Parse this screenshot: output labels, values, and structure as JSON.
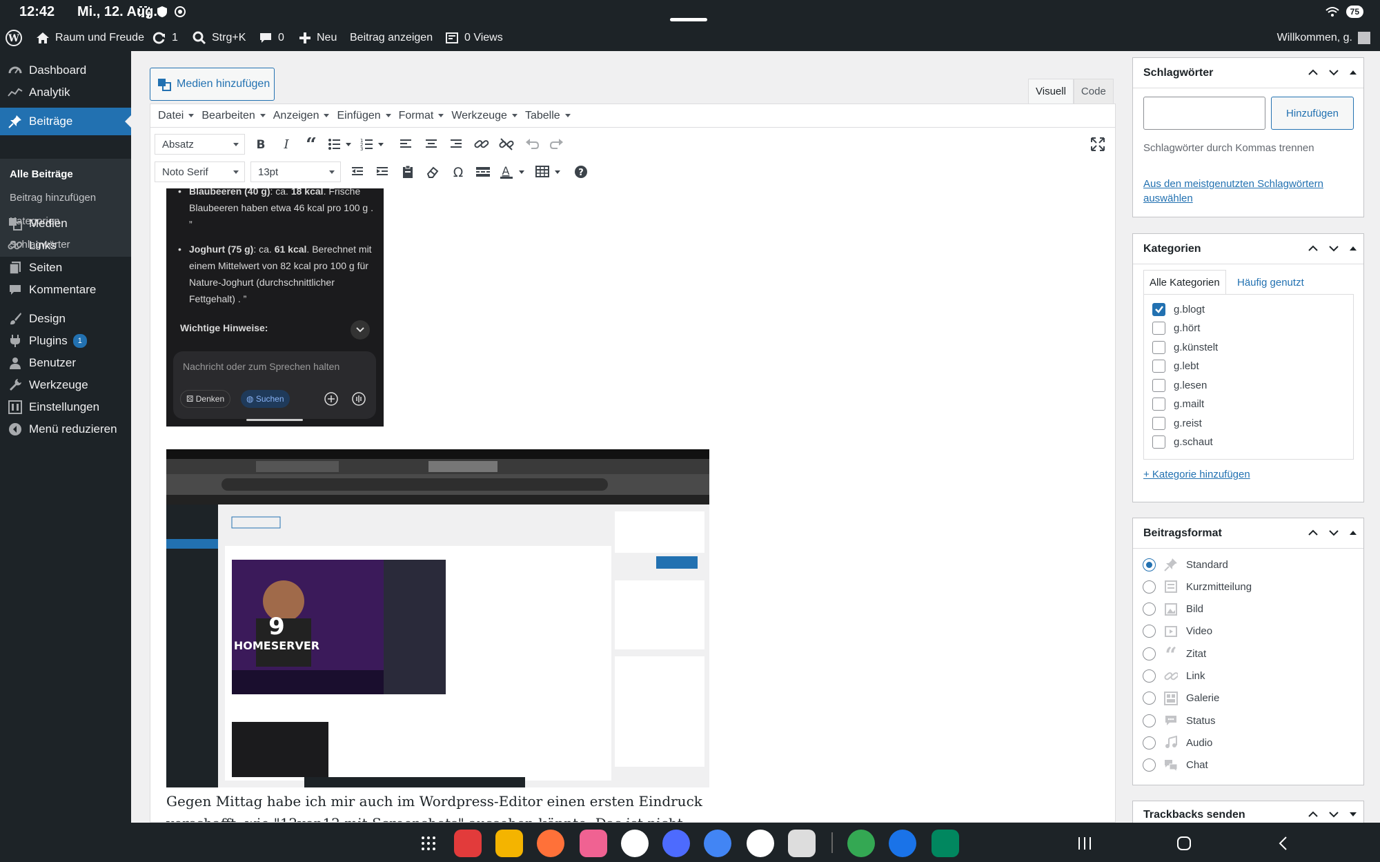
{
  "status_bar": {
    "time": "12:42",
    "date": "Mi., 12. Aug.",
    "battery": "75"
  },
  "admin_bar": {
    "site_name": "Raum und Freude",
    "updates": "1",
    "search": "Strg+K",
    "comments": "0",
    "new": "Neu",
    "view_post": "Beitrag anzeigen",
    "views": "0 Views",
    "welcome": "Willkommen, g."
  },
  "sidebar": {
    "items": [
      {
        "label": "Dashboard",
        "icon": "dashboard-icon"
      },
      {
        "label": "Analytik",
        "icon": "chart-icon"
      },
      {
        "label": "Beiträge",
        "icon": "pin-icon"
      },
      {
        "label": "Medien",
        "icon": "media-icon"
      },
      {
        "label": "Links",
        "icon": "link-icon"
      },
      {
        "label": "Seiten",
        "icon": "page-icon"
      },
      {
        "label": "Kommentare",
        "icon": "comment-icon"
      },
      {
        "label": "Design",
        "icon": "brush-icon"
      },
      {
        "label": "Plugins",
        "icon": "plugin-icon",
        "badge": "1"
      },
      {
        "label": "Benutzer",
        "icon": "user-icon"
      },
      {
        "label": "Werkzeuge",
        "icon": "wrench-icon"
      },
      {
        "label": "Einstellungen",
        "icon": "settings-icon"
      },
      {
        "label": "Menü reduzieren",
        "icon": "collapse-icon"
      }
    ],
    "submenu": [
      "Alle Beiträge",
      "Beitrag hinzufügen",
      "Kategorien",
      "Schlagwörter"
    ]
  },
  "editor": {
    "add_media": "Medien hinzufügen",
    "tab_visual": "Visuell",
    "tab_code": "Code",
    "menu": [
      "Datei",
      "Bearbeiten",
      "Anzeigen",
      "Einfügen",
      "Format",
      "Werkzeuge",
      "Tabelle"
    ],
    "format_select": "Absatz",
    "font_select": "Noto Serif",
    "size_select": "13pt"
  },
  "embedded_shot": {
    "bullet1_strong": "Blaubeeren (40 g)",
    "bullet1_mid": ": ca. ",
    "bullet1_kcal": "18 kcal",
    "bullet1_rest": ". Frische Blaubeeren haben etwa 46 kcal pro 100 g . ”",
    "bullet2_strong": "Joghurt (75 g)",
    "bullet2_mid": ": ca. ",
    "bullet2_kcal": "61 kcal",
    "bullet2_rest": ". Berechnet mit einem Mittelwert von 82 kcal pro 100 g für Nature-Joghurt (durchschnittlicher Fettgehalt) . ”",
    "hint_title": "Wichtige Hinweise:",
    "input_placeholder": "Nachricht oder zum Sprechen halten",
    "chip_think": "Denken",
    "chip_search": "Suchen",
    "screenshot_headline": "9 HOMESERVER"
  },
  "content_text": "Gegen Mittag habe ich mir auch im Wordpress-Editor einen ersten Eindruck verschafft, wie \"12von12 mit Screenshots\" aussehen könnte. Das ist nicht ganz so",
  "tags_panel": {
    "title": "Schlagwörter",
    "input_value": "",
    "add_button": "Hinzufügen",
    "hint": "Schlagwörter durch Kommas trennen",
    "popular_link": "Aus den meistgenutzten Schlagwörtern auswählen"
  },
  "categories_panel": {
    "title": "Kategorien",
    "tab_all": "Alle Kategorien",
    "tab_popular": "Häufig genutzt",
    "items": [
      {
        "label": "g.blogt",
        "checked": true
      },
      {
        "label": "g.hört",
        "checked": false
      },
      {
        "label": "g.künstelt",
        "checked": false
      },
      {
        "label": "g.lebt",
        "checked": false
      },
      {
        "label": "g.lesen",
        "checked": false
      },
      {
        "label": "g.mailt",
        "checked": false
      },
      {
        "label": "g.reist",
        "checked": false
      },
      {
        "label": "g.schaut",
        "checked": false
      }
    ],
    "add_link": "+ Kategorie hinzufügen"
  },
  "format_panel": {
    "title": "Beitragsformat",
    "options": [
      {
        "label": "Standard",
        "checked": true,
        "icon": "pin-icon"
      },
      {
        "label": "Kurzmitteilung",
        "checked": false,
        "icon": "aside-icon"
      },
      {
        "label": "Bild",
        "checked": false,
        "icon": "image-icon"
      },
      {
        "label": "Video",
        "checked": false,
        "icon": "video-icon"
      },
      {
        "label": "Zitat",
        "checked": false,
        "icon": "quote-icon"
      },
      {
        "label": "Link",
        "checked": false,
        "icon": "link-icon"
      },
      {
        "label": "Galerie",
        "checked": false,
        "icon": "gallery-icon"
      },
      {
        "label": "Status",
        "checked": false,
        "icon": "status-icon"
      },
      {
        "label": "Audio",
        "checked": false,
        "icon": "audio-icon"
      },
      {
        "label": "Chat",
        "checked": false,
        "icon": "chat-icon"
      }
    ]
  },
  "trackbacks_panel": {
    "title": "Trackbacks senden"
  },
  "colors": {
    "accent": "#2271b1",
    "admin_dark": "#1d2327",
    "sub_dark": "#2c3338"
  }
}
